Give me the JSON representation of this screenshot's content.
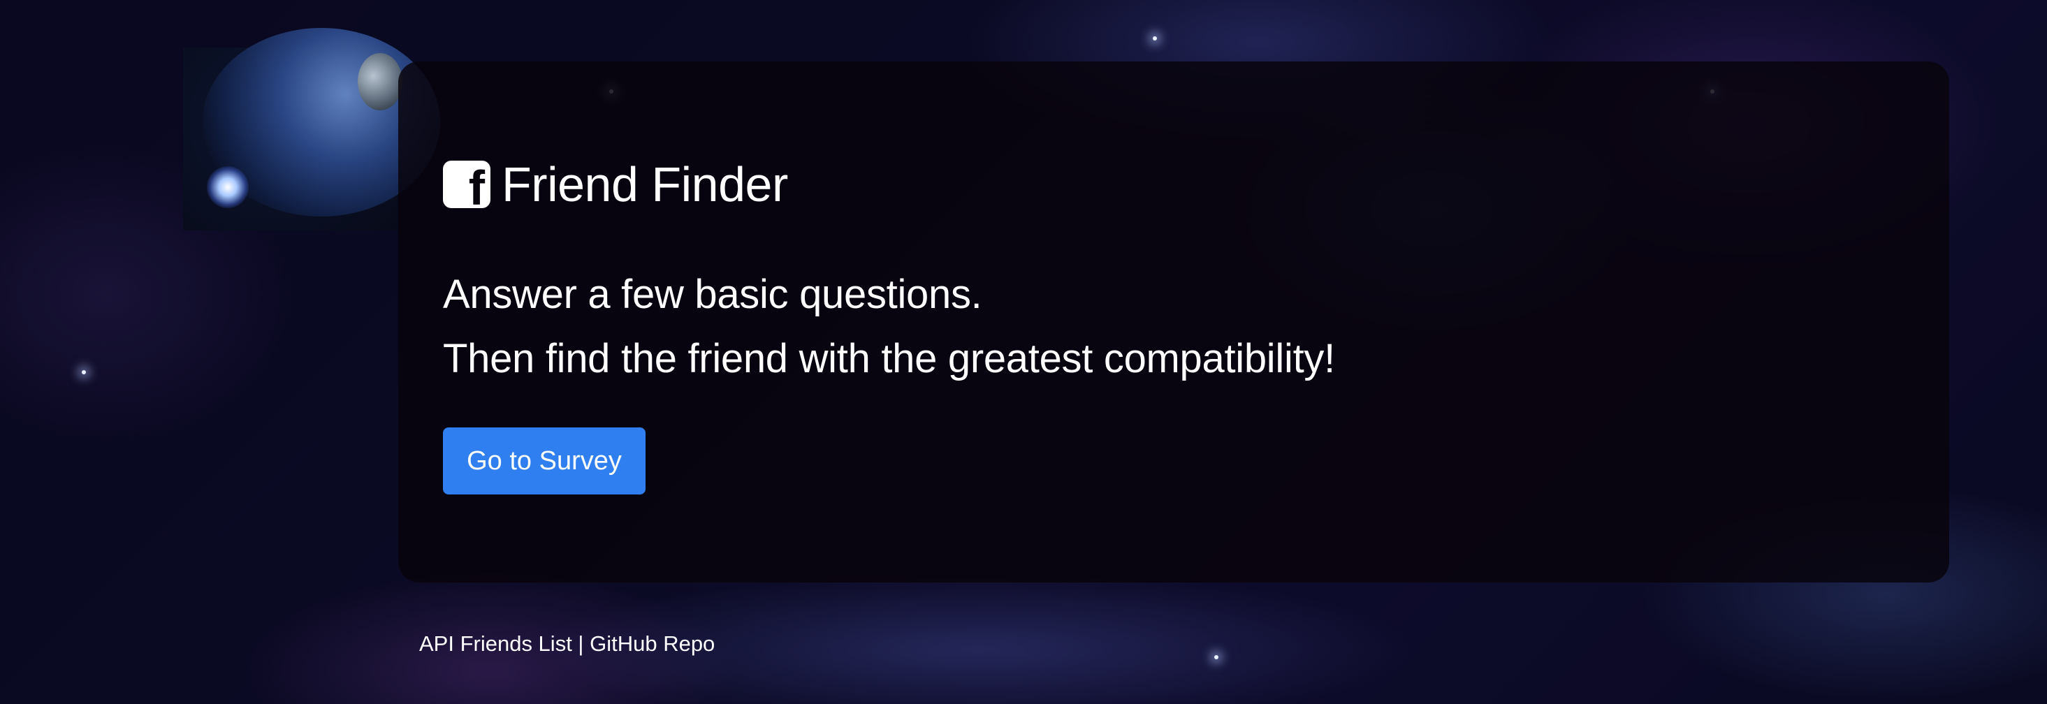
{
  "brand": {
    "icon": "facebook-square-icon",
    "title": "Friend Finder"
  },
  "lead": {
    "line1": "Answer a few basic questions.",
    "line2": "Then find the friend with the greatest compatibility!"
  },
  "actions": {
    "survey_button_label": "Go to Survey"
  },
  "footer": {
    "api_link_label": "API Friends List",
    "separator": " | ",
    "github_link_label": "GitHub Repo"
  },
  "colors": {
    "button_primary": "#2f7ff0",
    "jumbotron_bg": "#08040c",
    "text": "#ffffff"
  }
}
